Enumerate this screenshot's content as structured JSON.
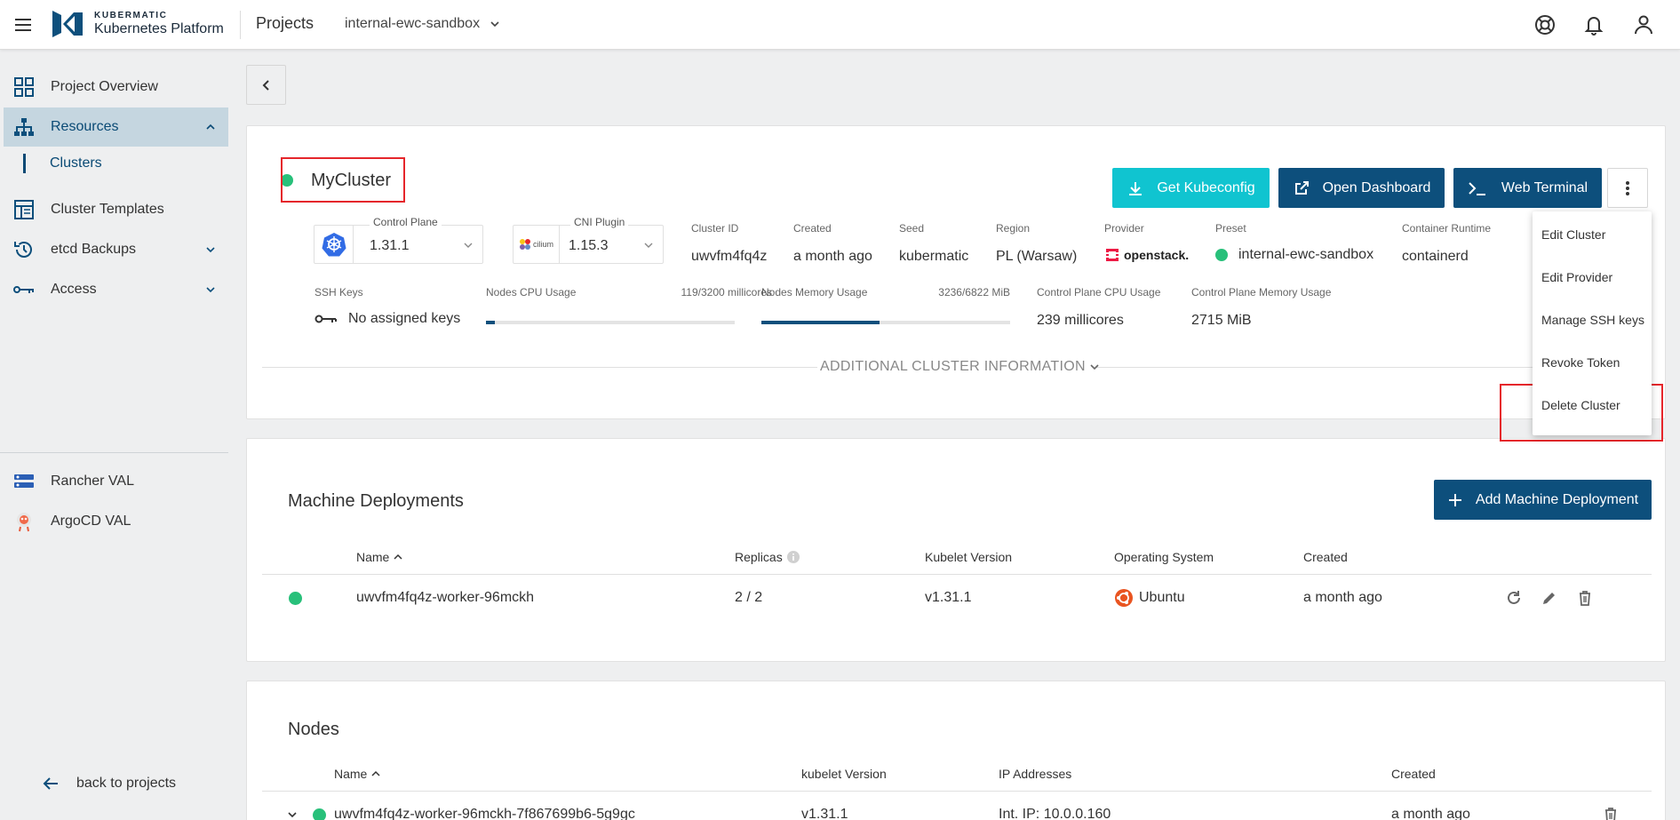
{
  "header": {
    "brand_top": "KUBERMATIC",
    "brand_bottom": "Kubernetes Platform",
    "projects_label": "Projects",
    "project_name": "internal-ewc-sandbox"
  },
  "sidebar": {
    "items": [
      {
        "label": "Project Overview",
        "icon": "grid-icon"
      },
      {
        "label": "Resources",
        "icon": "hierarchy-icon"
      },
      {
        "label": "Clusters"
      },
      {
        "label": "Cluster Templates",
        "icon": "template-icon"
      },
      {
        "label": "etcd Backups",
        "icon": "history-icon"
      },
      {
        "label": "Access",
        "icon": "key-icon"
      }
    ],
    "external": [
      {
        "label": "Rancher VAL",
        "icon": "rancher-icon"
      },
      {
        "label": "ArgoCD VAL",
        "icon": "argocd-icon"
      }
    ],
    "back_label": "back to projects"
  },
  "cluster": {
    "name": "MyCluster",
    "status_color": "#28c07a",
    "buttons": {
      "kubeconfig": "Get Kubeconfig",
      "dashboard": "Open Dashboard",
      "terminal": "Web Terminal"
    },
    "control_plane": {
      "label": "Control Plane",
      "value": "1.31.1"
    },
    "cni_plugin": {
      "label": "CNI Plugin",
      "value": "1.15.3",
      "logo_text": "cilium"
    },
    "info": [
      {
        "label": "Cluster ID",
        "value": "uwvfm4fq4z"
      },
      {
        "label": "Created",
        "value": "a month ago"
      },
      {
        "label": "Seed",
        "value": "kubermatic"
      },
      {
        "label": "Region",
        "value": "PL (Warsaw)"
      },
      {
        "label": "Provider",
        "value": "openstack."
      },
      {
        "label": "Preset",
        "value": "internal-ewc-sandbox"
      },
      {
        "label": "Container Runtime",
        "value": "containerd"
      }
    ],
    "ssh_keys": {
      "label": "SSH Keys",
      "value": "No assigned keys"
    },
    "cpu_usage": {
      "label": "Nodes CPU Usage",
      "value": "119/3200 millicores",
      "fraction": 0.037
    },
    "memory_usage": {
      "label": "Nodes Memory Usage",
      "value": "3236/6822 MiB",
      "fraction": 0.474
    },
    "cp_cpu": {
      "label": "Control Plane CPU Usage",
      "value": "239 millicores"
    },
    "cp_memory": {
      "label": "Control Plane Memory Usage",
      "value": "2715 MiB"
    },
    "additional_info": "ADDITIONAL CLUSTER INFORMATION"
  },
  "menu": {
    "items": [
      "Edit Cluster",
      "Edit Provider",
      "Manage SSH keys",
      "Revoke Token",
      "Delete Cluster"
    ]
  },
  "machine_deployments": {
    "title": "Machine Deployments",
    "add_button": "Add Machine Deployment",
    "columns": [
      "Name",
      "Replicas",
      "Kubelet Version",
      "Operating System",
      "Created"
    ],
    "rows": [
      {
        "name": "uwvfm4fq4z-worker-96mckh",
        "replicas": "2 / 2",
        "kubelet": "v1.31.1",
        "os": "Ubuntu",
        "created": "a month ago"
      }
    ]
  },
  "nodes": {
    "title": "Nodes",
    "columns": [
      "Name",
      "kubelet Version",
      "IP Addresses",
      "Created"
    ],
    "rows": [
      {
        "name": "uwvfm4fq4z-worker-96mckh-7f867699b6-5g9gc",
        "kubelet": "v1.31.1",
        "ip": "Int. IP: 10.0.0.160",
        "created": "a month ago"
      }
    ]
  }
}
